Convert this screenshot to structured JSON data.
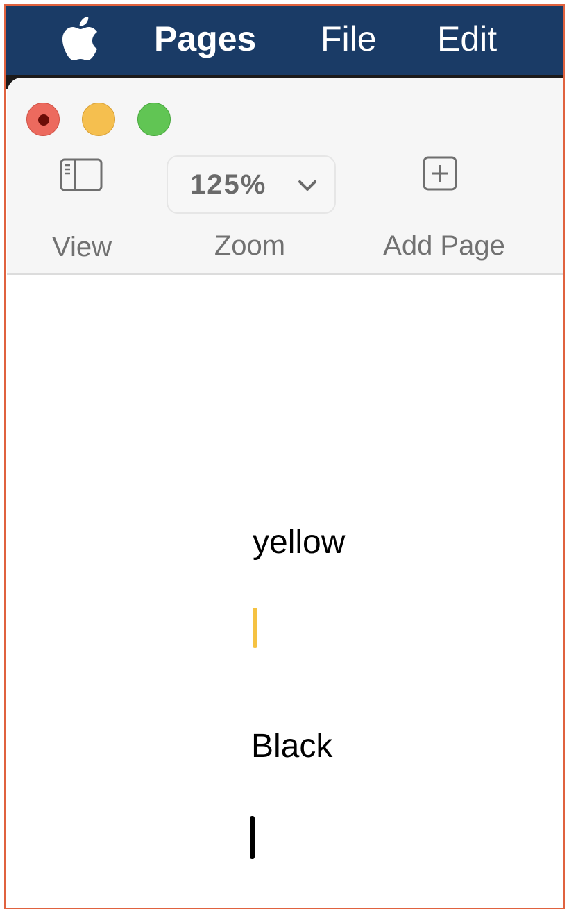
{
  "menubar": {
    "app_name": "Pages",
    "items": [
      "File",
      "Edit"
    ],
    "icon": "apple-logo-icon",
    "background": "#1a3b66"
  },
  "window": {
    "controls": {
      "close": "#ec6a5e",
      "minimize": "#f5bf4f",
      "zoom": "#61c554"
    },
    "toolbar": {
      "view": {
        "label": "View",
        "icon": "sidebar-icon"
      },
      "zoom": {
        "label": "Zoom",
        "value": "125%",
        "icon": "chevron-down-icon"
      },
      "add_page": {
        "label": "Add Page",
        "icon": "plus-square-icon"
      }
    }
  },
  "document": {
    "lines": [
      {
        "text": "yellow",
        "caret_color": "#f5c242"
      },
      {
        "text": "Black",
        "caret_color": "#000000"
      }
    ]
  }
}
